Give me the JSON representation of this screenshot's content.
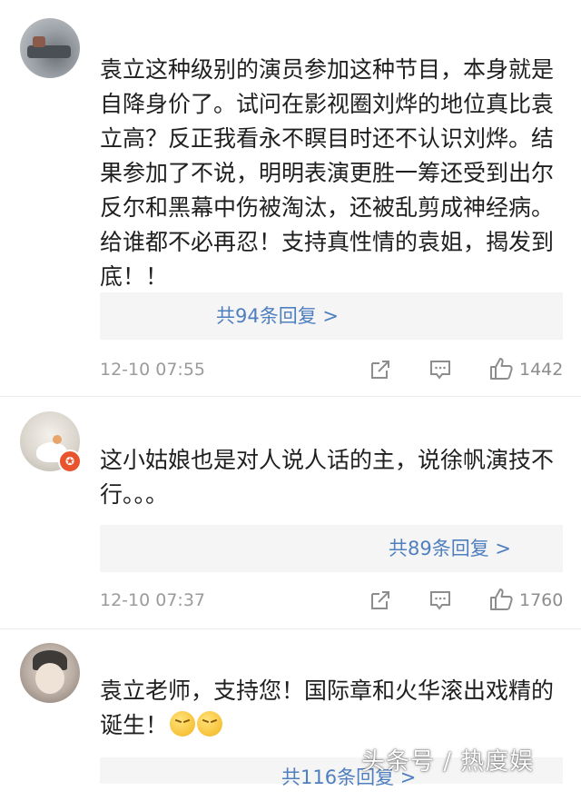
{
  "comments": [
    {
      "text": "袁立这种级别的演员参加这种节目，本身就是自降身价了。试问在影视圈刘烨的地位真比袁立高？反正我看永不瞑目时还不认识刘烨。结果参加了不说，明明表演更胜一筹还受到出尔反尔和黑幕中伤被淘汰，还被乱剪成神经病。给谁都不必再忍！支持真性情的袁姐，揭发到底！！",
      "replies": "共94条回复 >",
      "time": "12-10 07:55",
      "likes": "1442"
    },
    {
      "text": "这小姑娘也是对人说人话的主，说徐帆演技不行。。。",
      "replies": "共89条回复 >",
      "time": "12-10 07:37",
      "likes": "1760",
      "badge_icon": "verified-badge-icon"
    },
    {
      "text": "袁立老师，支持您！国际章和火华滚出戏精的诞生！",
      "replies": "共116条回复 >"
    }
  ],
  "watermark": "头条号 / 热度娱",
  "colors": {
    "link": "#4f7fbf",
    "meta": "#9b9b9b",
    "badge": "#e8542d"
  }
}
